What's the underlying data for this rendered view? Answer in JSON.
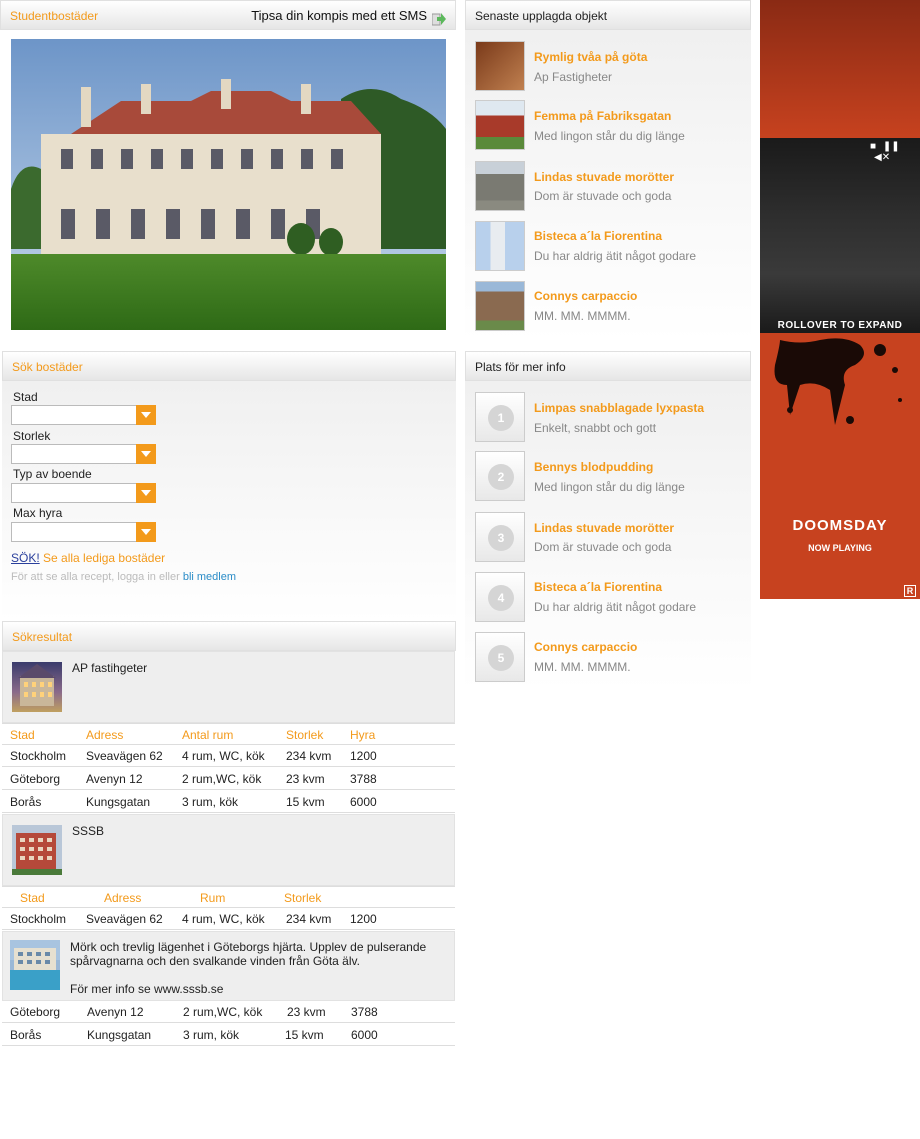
{
  "left_header": {
    "title": "Studentbostäder",
    "sms_link": "Tipsa din kompis med ett SMS"
  },
  "search": {
    "title": "Sök bostäder",
    "fields": [
      {
        "label": "Stad",
        "value": ""
      },
      {
        "label": "Storlek",
        "value": ""
      },
      {
        "label": "Typ av boende",
        "value": ""
      },
      {
        "label": "Max hyra",
        "value": ""
      }
    ],
    "search_button": "SÖK!",
    "see_all_link": "Se alla lediga bostäder",
    "login_hint": "För att se alla recept, logga in eller",
    "member_link": "bli medlem"
  },
  "results": {
    "title": "Sökresultat",
    "company1": {
      "name": "AP fastihgeter",
      "headers": [
        "Stad",
        "Adress",
        "Antal rum",
        "Storlek",
        "Hyra"
      ],
      "rows": [
        [
          "Stockholm",
          "Sveavägen 62",
          "4 rum, WC, kök",
          "234 kvm",
          "1200"
        ],
        [
          "Göteborg",
          "Avenyn 12",
          "2 rum,WC, kök",
          "23 kvm",
          "3788"
        ],
        [
          "Borås",
          "Kungsgatan",
          "3 rum, kök",
          "15 kvm",
          "6000"
        ]
      ]
    },
    "company2": {
      "name": "SSSB",
      "headers": [
        "Stad",
        "Adress",
        "Rum",
        "Storlek"
      ],
      "row1": [
        "Stockholm",
        "Sveavägen 62",
        "4 rum, WC, kök",
        "234 kvm",
        "1200"
      ],
      "description": "Mörk och trevlig lägenhet i Göteborgs hjärta. Upplev de pulserande spårvagnarna och den svalkande vinden från Göta älv.",
      "more_info": "För mer info se www.sssb.se",
      "rows": [
        [
          "Göteborg",
          "Avenyn 12",
          "2 rum,WC, kök",
          "23 kvm",
          "3788"
        ],
        [
          "Borås",
          "Kungsgatan",
          "3 rum, kök",
          "15 kvm",
          "6000"
        ]
      ]
    }
  },
  "latest": {
    "title": "Senaste upplagda objekt",
    "items": [
      {
        "title": "Rymlig tvåa på göta",
        "sub": "Ap Fastigheter"
      },
      {
        "title": "Femma på Fabriksgatan",
        "sub": "Med lingon står du dig länge"
      },
      {
        "title": "Lindas stuvade morötter",
        "sub": "Dom är stuvade och goda"
      },
      {
        "title": "Bisteca a´la Fiorentina",
        "sub": "Du har aldrig ätit något godare"
      },
      {
        "title": "Connys carpaccio",
        "sub": "MM. MM. MMMM."
      }
    ]
  },
  "info": {
    "title": "Plats för mer info",
    "items": [
      {
        "num": "1",
        "title": "Limpas snabblagade lyxpasta",
        "sub": "Enkelt, snabbt och gott"
      },
      {
        "num": "2",
        "title": "Bennys blodpudding",
        "sub": "Med lingon står du dig länge"
      },
      {
        "num": "3",
        "title": "Lindas stuvade morötter",
        "sub": "Dom är stuvade och goda"
      },
      {
        "num": "4",
        "title": "Bisteca a´la Fiorentina",
        "sub": "Du har aldrig ätit något godare"
      },
      {
        "num": "5",
        "title": "Connys carpaccio",
        "sub": "MM. MM. MMMM."
      }
    ]
  },
  "ad": {
    "rollover": "ROLLOVER TO EXPAND",
    "title": "DOOMSDAY",
    "tagline": "NOW PLAYING",
    "rating": "R"
  }
}
